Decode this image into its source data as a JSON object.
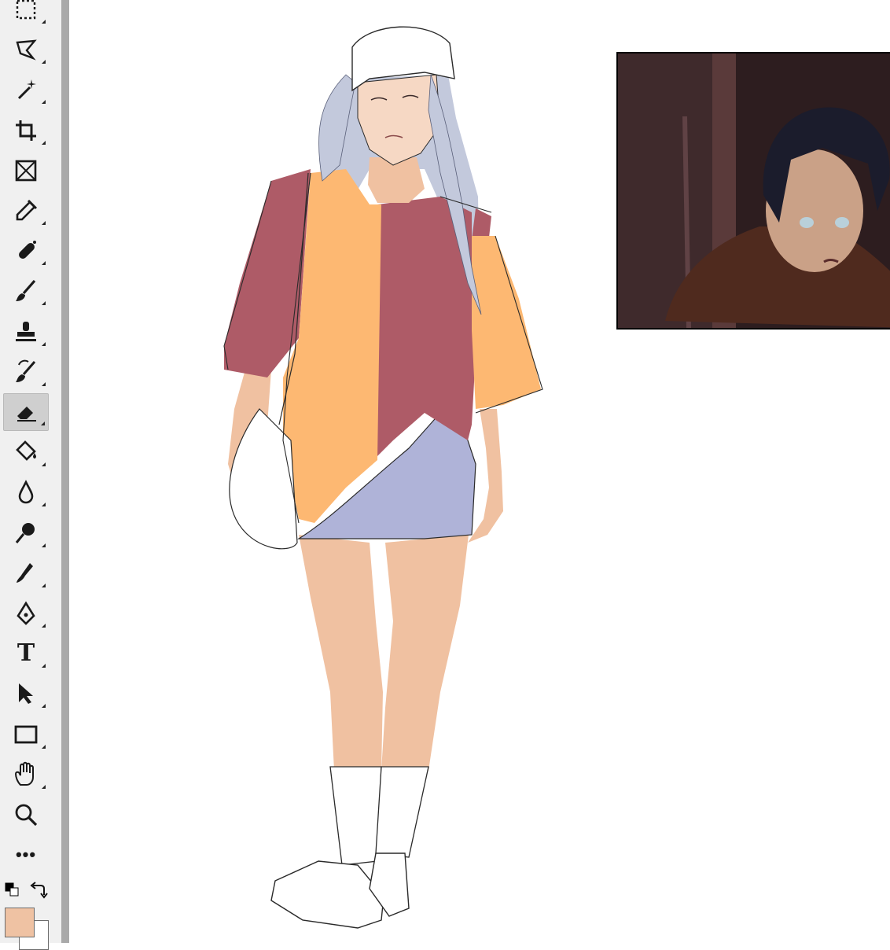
{
  "app": {
    "toolbar": {
      "tools": [
        {
          "name": "rectangular-marquee-icon",
          "has_flyout": true,
          "active": false
        },
        {
          "name": "lasso-icon",
          "has_flyout": true,
          "active": false
        },
        {
          "name": "magic-wand-icon",
          "has_flyout": true,
          "active": false
        },
        {
          "name": "crop-icon",
          "has_flyout": true,
          "active": false
        },
        {
          "name": "frame-icon",
          "has_flyout": false,
          "active": false
        },
        {
          "name": "eyedropper-icon",
          "has_flyout": true,
          "active": false
        },
        {
          "name": "spot-healing-brush-icon",
          "has_flyout": true,
          "active": false
        },
        {
          "name": "brush-icon",
          "has_flyout": true,
          "active": false
        },
        {
          "name": "clone-stamp-icon",
          "has_flyout": true,
          "active": false
        },
        {
          "name": "history-brush-icon",
          "has_flyout": true,
          "active": false
        },
        {
          "name": "eraser-icon",
          "has_flyout": true,
          "active": true
        },
        {
          "name": "paint-bucket-icon",
          "has_flyout": true,
          "active": false
        },
        {
          "name": "blur-icon",
          "has_flyout": true,
          "active": false
        },
        {
          "name": "dodge-icon",
          "has_flyout": true,
          "active": false
        },
        {
          "name": "smudge-icon",
          "has_flyout": true,
          "active": false
        },
        {
          "name": "pen-icon",
          "has_flyout": true,
          "active": false
        },
        {
          "name": "type-icon",
          "has_flyout": true,
          "active": false,
          "glyph": "T"
        },
        {
          "name": "path-selection-icon",
          "has_flyout": true,
          "active": false
        },
        {
          "name": "rectangle-icon",
          "has_flyout": true,
          "active": false
        },
        {
          "name": "hand-icon",
          "has_flyout": true,
          "active": false
        },
        {
          "name": "zoom-icon",
          "has_flyout": false,
          "active": false
        },
        {
          "name": "more-tools-icon",
          "has_flyout": false,
          "active": false,
          "glyph": "•••"
        }
      ]
    },
    "colors": {
      "foreground": "#efc2a3",
      "background": "#ffffff",
      "toolbar_bg": "#f0f0f0",
      "toolbar_edge": "#a9a9a9",
      "active_tool_bg": "#cfcfcf"
    }
  },
  "artwork": {
    "palette": {
      "skin": "#f0c1a1",
      "shirt_yellow": "#fdb872",
      "shirt_maroon": "#ae5b67",
      "skirt": "#afb3d8",
      "hair": "#c3c9dc",
      "line": "#2a2a2a"
    }
  },
  "reference_image": {
    "bg_dark": "#2d1d1f",
    "bg_warm": "#5a3a3a",
    "hair": "#1b1c2c",
    "skin": "#caa187",
    "jacket": "#4f2a1e"
  }
}
